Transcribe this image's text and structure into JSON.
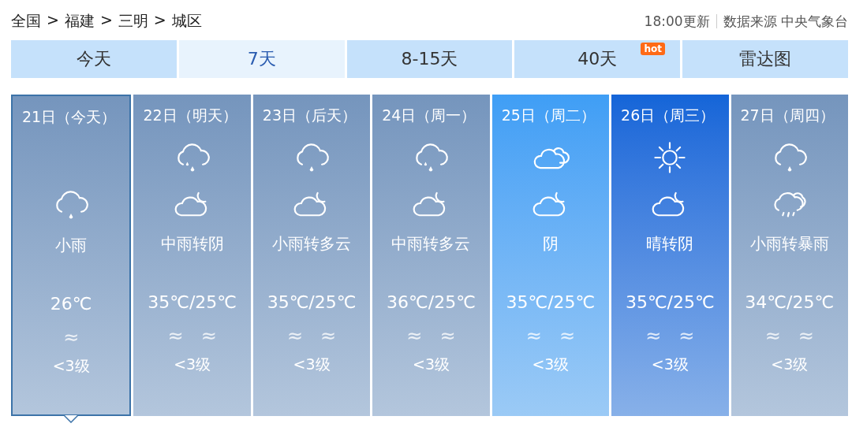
{
  "breadcrumb": [
    "全国",
    "福建",
    "三明",
    "城区"
  ],
  "breadcrumb_separator": ">",
  "update_time": "18:00更新",
  "source": "数据来源 中央气象台",
  "tabs": [
    {
      "label": "今天",
      "selected": false
    },
    {
      "label": "7天",
      "selected": true
    },
    {
      "label": "8-15天",
      "selected": false
    },
    {
      "label": "40天",
      "selected": false,
      "badge": "hot"
    },
    {
      "label": "雷达图",
      "selected": false
    }
  ],
  "days": [
    {
      "date": "21日（今天）",
      "selected": true,
      "color": "#7595bd",
      "icons": [
        {
          "kind": "none"
        },
        {
          "kind": "light-rain"
        }
      ],
      "weather": "小雨",
      "temperature": "26℃",
      "winds": [
        "≈"
      ],
      "wind_level": "<3级"
    },
    {
      "date": "22日（明天）",
      "selected": false,
      "color": "#7595bd",
      "icons": [
        {
          "kind": "moderate-rain"
        },
        {
          "kind": "cloudy-night"
        }
      ],
      "weather": "中雨转阴",
      "temperature": "35℃/25℃",
      "winds": [
        "≈",
        "≈"
      ],
      "wind_level": "<3级"
    },
    {
      "date": "23日（后天）",
      "selected": false,
      "color": "#7595bd",
      "icons": [
        {
          "kind": "light-rain"
        },
        {
          "kind": "cloudy-night"
        }
      ],
      "weather": "小雨转多云",
      "temperature": "35℃/25℃",
      "winds": [
        "≈",
        "≈"
      ],
      "wind_level": "<3级"
    },
    {
      "date": "24日（周一）",
      "selected": false,
      "color": "#7595bd",
      "icons": [
        {
          "kind": "moderate-rain"
        },
        {
          "kind": "cloudy-night"
        }
      ],
      "weather": "中雨转多云",
      "temperature": "36℃/25℃",
      "winds": [
        "≈",
        "≈"
      ],
      "wind_level": "<3级"
    },
    {
      "date": "25日（周二）",
      "selected": false,
      "color": "#3f9ef5",
      "icons": [
        {
          "kind": "overcast"
        },
        {
          "kind": "cloudy-night"
        }
      ],
      "weather": "阴",
      "temperature": "35℃/25℃",
      "winds": [
        "≈",
        "≈"
      ],
      "wind_level": "<3级"
    },
    {
      "date": "26日（周三）",
      "selected": false,
      "color": "#1465d8",
      "icons": [
        {
          "kind": "sunny"
        },
        {
          "kind": "cloudy-night"
        }
      ],
      "weather": "晴转阴",
      "temperature": "35℃/25℃",
      "winds": [
        "≈",
        "≈"
      ],
      "wind_level": "<3级"
    },
    {
      "date": "27日（周四）",
      "selected": false,
      "color": "#7595bd",
      "icons": [
        {
          "kind": "light-rain"
        },
        {
          "kind": "rainstorm"
        }
      ],
      "weather": "小雨转暴雨",
      "temperature": "34℃/25℃",
      "winds": [
        "≈",
        "≈"
      ],
      "wind_level": "<3级"
    }
  ]
}
